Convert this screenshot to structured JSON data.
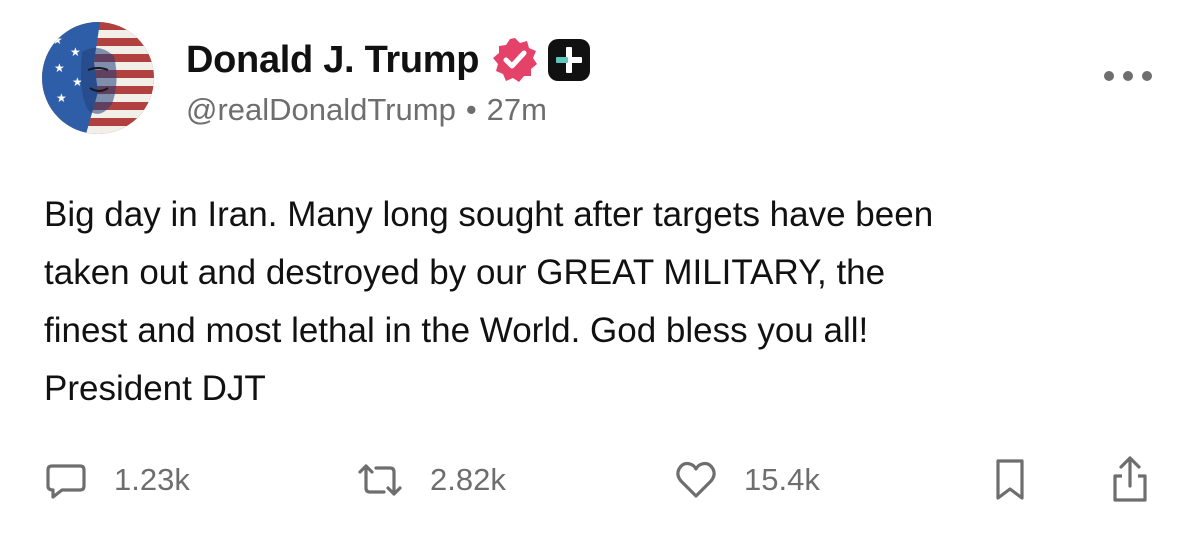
{
  "post": {
    "author": {
      "display_name": "Donald J. Trump",
      "handle": "@realDonaldTrump",
      "separator": "•",
      "time": "27m"
    },
    "text": "Big day in Iran. Many long sought after targets have been\ntaken out and destroyed by our GREAT MILITARY, the\nfinest and most lethal in the World. God bless you all!\nPresident DJT",
    "actions": {
      "replies": "1.23k",
      "reposts": "2.82k",
      "likes": "15.4k"
    }
  },
  "icons": {
    "verified": "verified-badge-icon",
    "plus": "plus-badge-icon",
    "more": "more-options-icon",
    "reply": "reply-icon",
    "repost": "repost-icon",
    "like": "heart-icon",
    "bookmark": "bookmark-icon",
    "share": "share-icon"
  },
  "colors": {
    "verified_badge": "#e5426a",
    "text_primary": "#111111",
    "text_secondary": "#6e6e6e"
  }
}
